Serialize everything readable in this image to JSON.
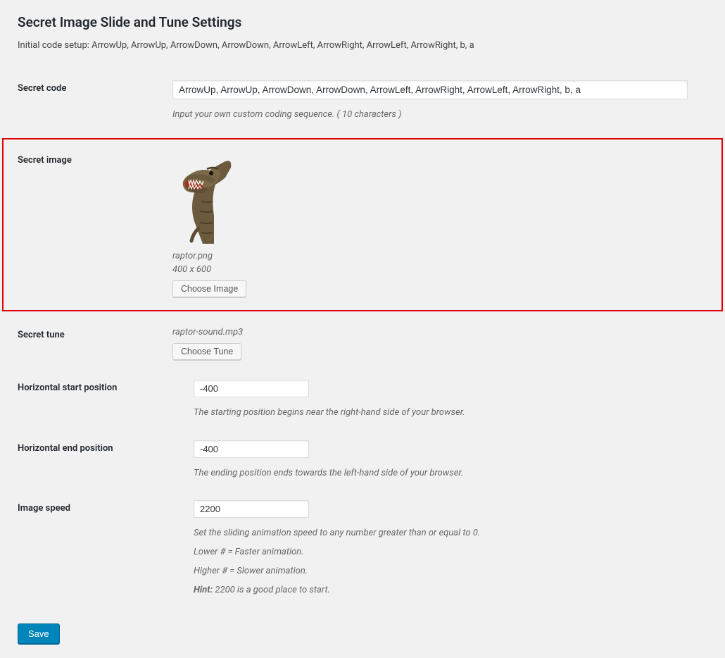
{
  "page": {
    "title": "Secret Image Slide and Tune Settings",
    "intro": "Initial code setup: ArrowUp, ArrowUp, ArrowDown, ArrowDown, ArrowLeft, ArrowRight, ArrowLeft, ArrowRight, b, a"
  },
  "secretCode": {
    "label": "Secret code",
    "value": "ArrowUp, ArrowUp, ArrowDown, ArrowDown, ArrowLeft, ArrowRight, ArrowLeft, ArrowRight, b, a",
    "description": "Input your own custom coding sequence. ( 10 characters )"
  },
  "secretImage": {
    "label": "Secret image",
    "filename": "raptor.png",
    "dimensions": "400 x 600",
    "buttonLabel": "Choose Image"
  },
  "secretTune": {
    "label": "Secret tune",
    "filename": "raptor-sound.mp3",
    "buttonLabel": "Choose Tune"
  },
  "hStart": {
    "label": "Horizontal start position",
    "value": "-400",
    "description": "The starting position begins near the right-hand side of your browser."
  },
  "hEnd": {
    "label": "Horizontal end position",
    "value": "-400",
    "description": "The ending position ends towards the left-hand side of your browser."
  },
  "imageSpeed": {
    "label": "Image speed",
    "value": "2200",
    "desc1": "Set the sliding animation speed to any number greater than or equal to 0.",
    "desc2": "Lower # = Faster animation.",
    "desc3": "Higher # = Slower animation.",
    "hintLabel": "Hint:",
    "hintText": " 2200 is a good place to start."
  },
  "save": {
    "label": "Save"
  }
}
